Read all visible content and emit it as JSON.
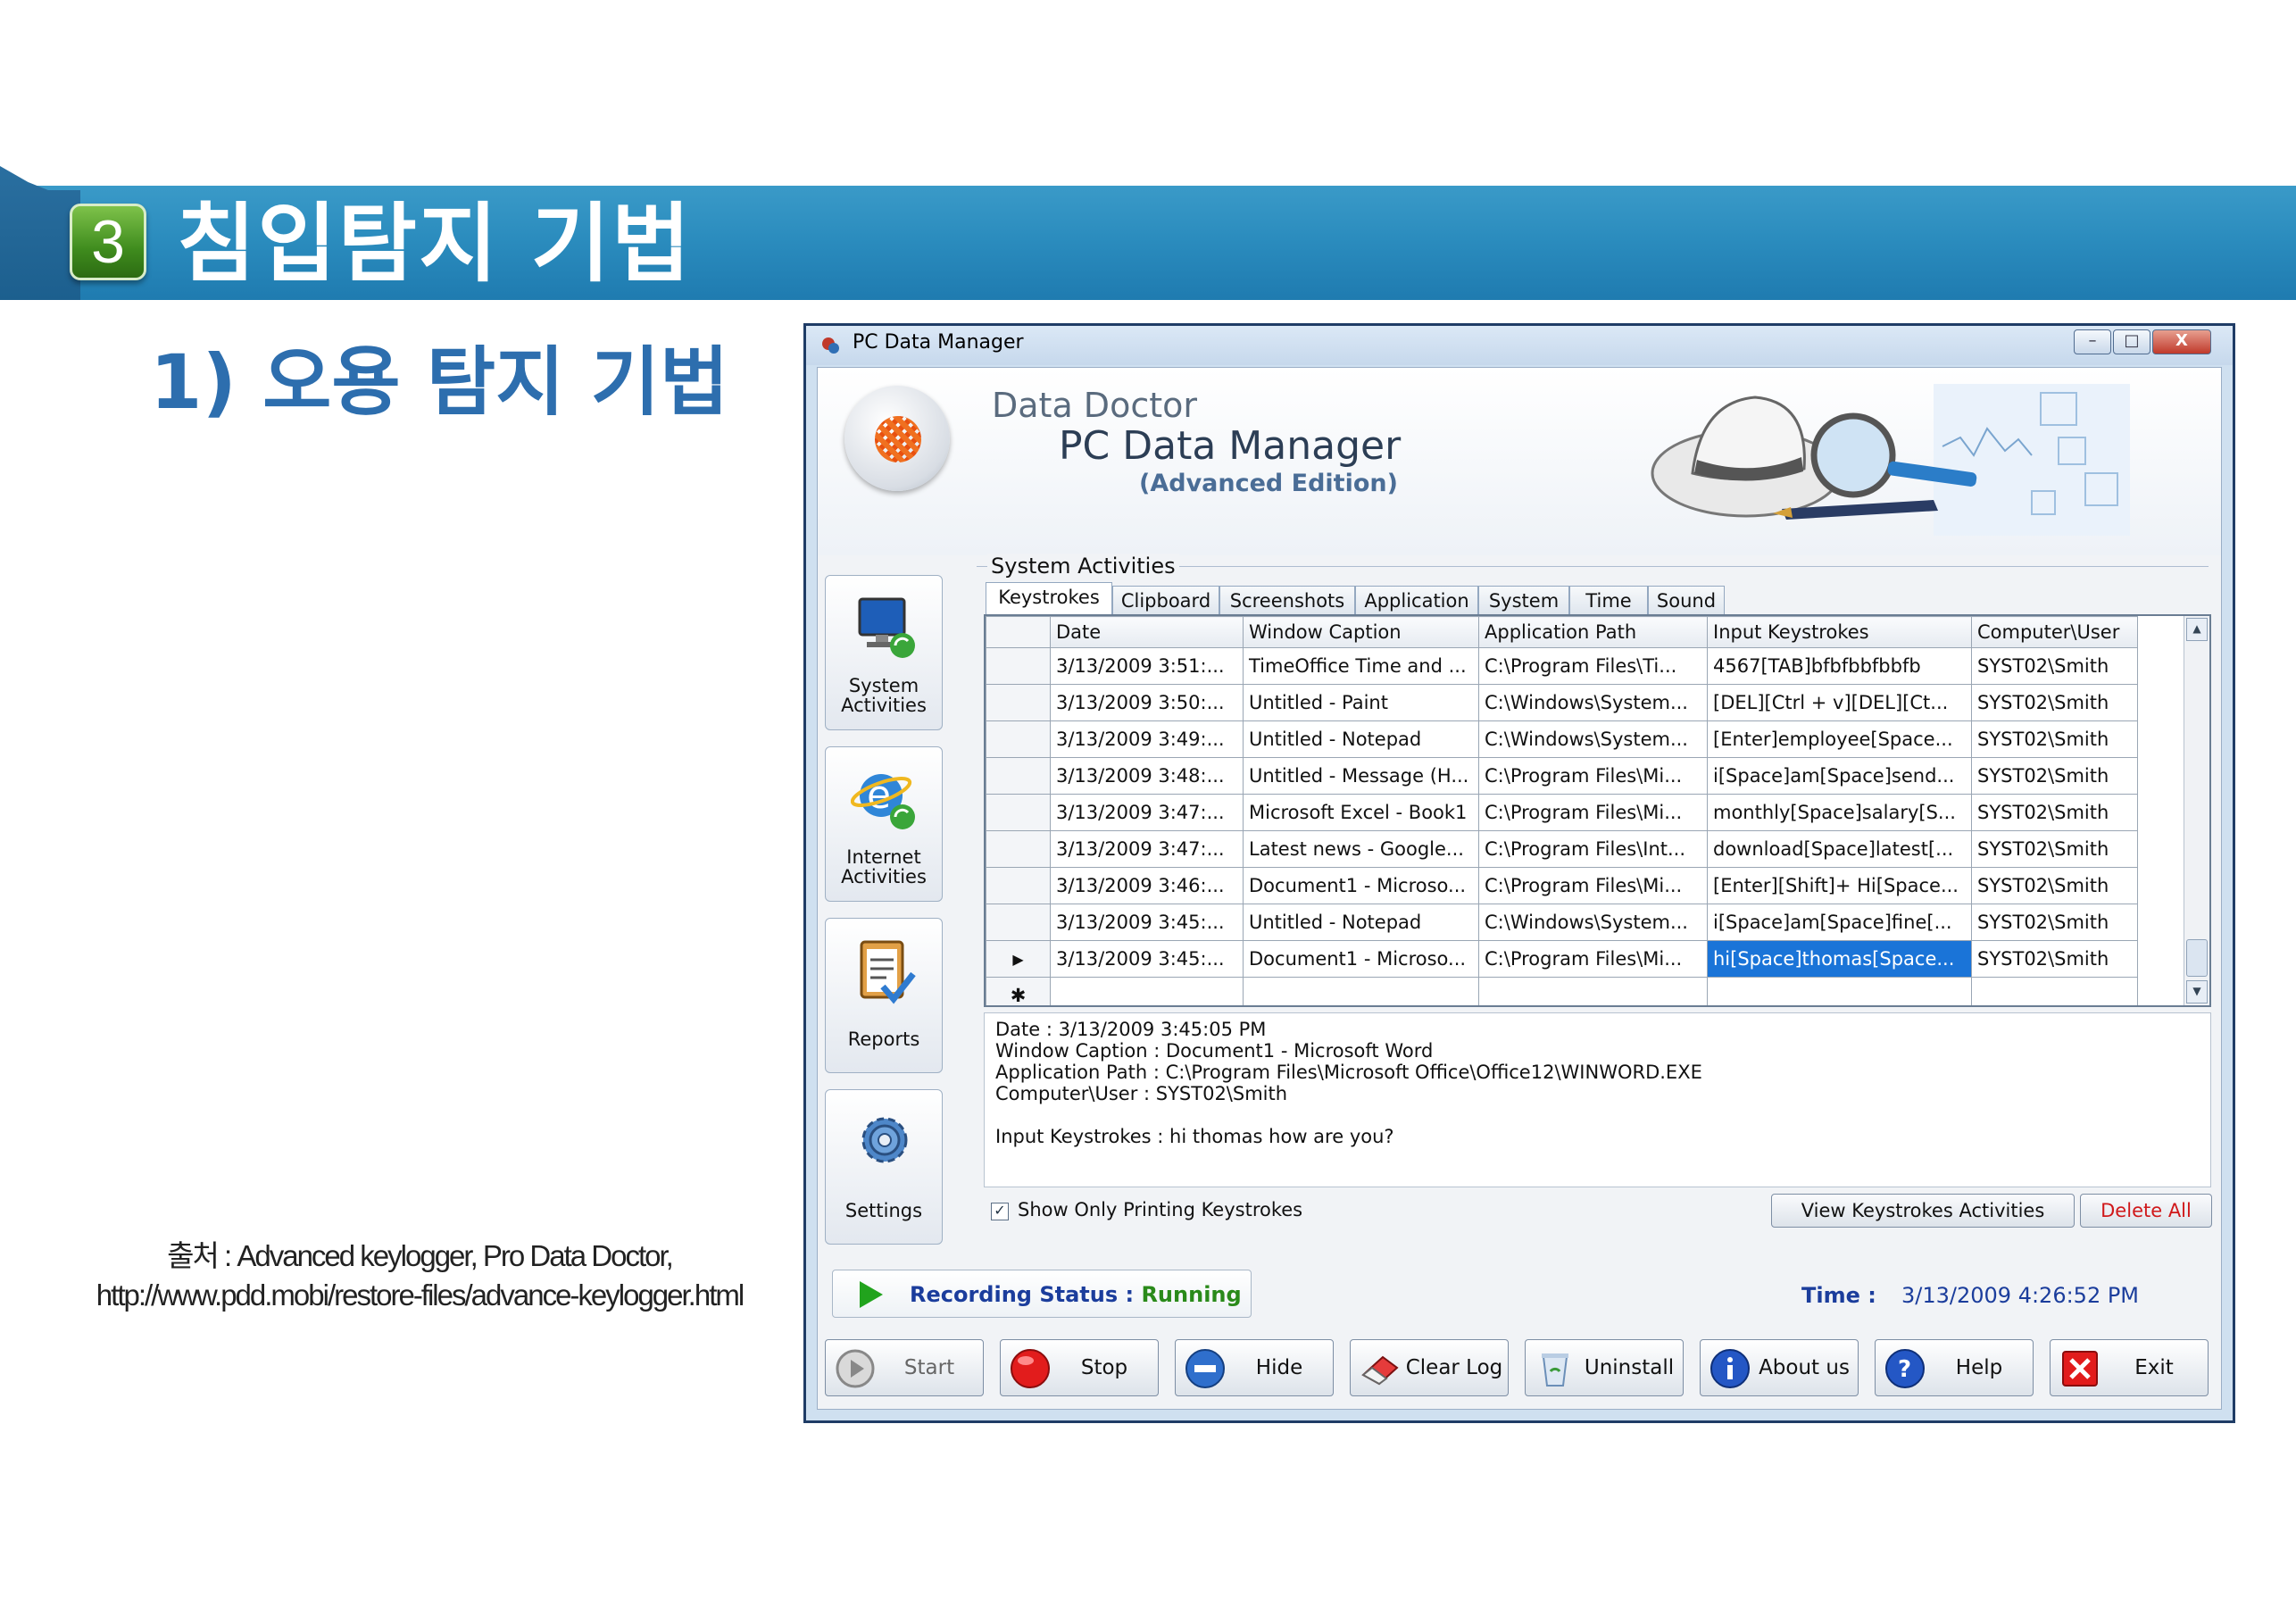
{
  "slide": {
    "badge_number": "3",
    "title": "침입탐지 기법",
    "subtitle": "1) 오용 탐지 기법",
    "source_line1": "출처 : Advanced keylogger, Pro Data Doctor,",
    "source_line2": "http://www.pdd.mobi/restore-files/advance-keylogger.html",
    "banner_color": "#2a8bbd",
    "subtitle_color": "#2d6eae"
  },
  "window": {
    "title": "PC Data Manager",
    "controls": {
      "minimize": "–",
      "maximize": "□",
      "close": "X"
    }
  },
  "header": {
    "brand_line1": "Data Doctor",
    "brand_line2": "PC Data Manager",
    "brand_line3": "(Advanced Edition)"
  },
  "sidebar": {
    "items": [
      {
        "label": "System\nActivities",
        "icon": "monitor-icon"
      },
      {
        "label": "Internet\nActivities",
        "icon": "internet-explorer-icon"
      },
      {
        "label": "Reports",
        "icon": "clipboard-icon"
      },
      {
        "label": "Settings",
        "icon": "gear-icon"
      }
    ]
  },
  "main": {
    "group_title": "System Activities",
    "tabs": [
      "Keystrokes",
      "Clipboard",
      "Screenshots",
      "Application",
      "System",
      "Time",
      "Sound"
    ],
    "active_tab": "Keystrokes",
    "columns": [
      "Date",
      "Window Caption",
      "Application Path",
      "Input Keystrokes",
      "Computer\\User"
    ],
    "rows": [
      [
        "3/13/2009 3:51:...",
        "TimeOffice Time and ...",
        "C:\\Program Files\\Ti...",
        "4567[TAB]bfbfbbfbbfb",
        "SYST02\\Smith"
      ],
      [
        "3/13/2009 3:50:...",
        "Untitled - Paint",
        "C:\\Windows\\System...",
        "[DEL][Ctrl + v][DEL][Ct...",
        "SYST02\\Smith"
      ],
      [
        "3/13/2009 3:49:...",
        "Untitled - Notepad",
        "C:\\Windows\\System...",
        "[Enter]employee[Space...",
        "SYST02\\Smith"
      ],
      [
        "3/13/2009 3:48:...",
        "Untitled - Message (H...",
        "C:\\Program Files\\Mi...",
        "i[Space]am[Space]send...",
        "SYST02\\Smith"
      ],
      [
        "3/13/2009 3:47:...",
        "Microsoft Excel - Book1",
        "C:\\Program Files\\Mi...",
        "monthly[Space]salary[S...",
        "SYST02\\Smith"
      ],
      [
        "3/13/2009 3:47:...",
        "Latest news - Google...",
        "C:\\Program Files\\Int...",
        "download[Space]latest[...",
        "SYST02\\Smith"
      ],
      [
        "3/13/2009 3:46:...",
        "Document1 - Microso...",
        "C:\\Program Files\\Mi...",
        "[Enter][Shift]+ Hi[Space...",
        "SYST02\\Smith"
      ],
      [
        "3/13/2009 3:45:...",
        "Untitled - Notepad",
        "C:\\Windows\\System...",
        "i[Space]am[Space]fine[...",
        "SYST02\\Smith"
      ],
      [
        "3/13/2009 3:45:...",
        "Document1 - Microso...",
        "C:\\Program Files\\Mi...",
        "hi[Space]thomas[Space...",
        "SYST02\\Smith"
      ]
    ],
    "current_row_marker": "▶",
    "new_row_marker": "✱",
    "selection_color": "#1a74d8",
    "detail": {
      "date": "Date : 3/13/2009 3:45:05 PM",
      "caption": "Window Caption : Document1 - Microsoft Word",
      "path": "Application Path : C:\\Program Files\\Microsoft Office\\Office12\\WINWORD.EXE",
      "user": "Computer\\User : SYST02\\Smith",
      "keys": "Input Keystrokes : hi thomas how are you?"
    },
    "show_printing_label": "Show Only Printing Keystrokes",
    "show_printing_checked": true,
    "view_button": "View Keystrokes Activities",
    "delete_button": "Delete All"
  },
  "status": {
    "recording_label": "Recording Status :",
    "recording_value": "Running",
    "time_label": "Time :",
    "time_value": "3/13/2009 4:26:52 PM"
  },
  "toolbar": [
    {
      "label": "Start",
      "icon": "play-icon",
      "enabled": false
    },
    {
      "label": "Stop",
      "icon": "stop-icon",
      "enabled": true
    },
    {
      "label": "Hide",
      "icon": "minus-circle-icon",
      "enabled": true
    },
    {
      "label": "Clear Log",
      "icon": "eraser-icon",
      "enabled": true
    },
    {
      "label": "Uninstall",
      "icon": "recycle-bin-icon",
      "enabled": true
    },
    {
      "label": "About us",
      "icon": "info-icon",
      "enabled": true
    },
    {
      "label": "Help",
      "icon": "help-icon",
      "enabled": true
    },
    {
      "label": "Exit",
      "icon": "exit-icon",
      "enabled": true
    }
  ]
}
